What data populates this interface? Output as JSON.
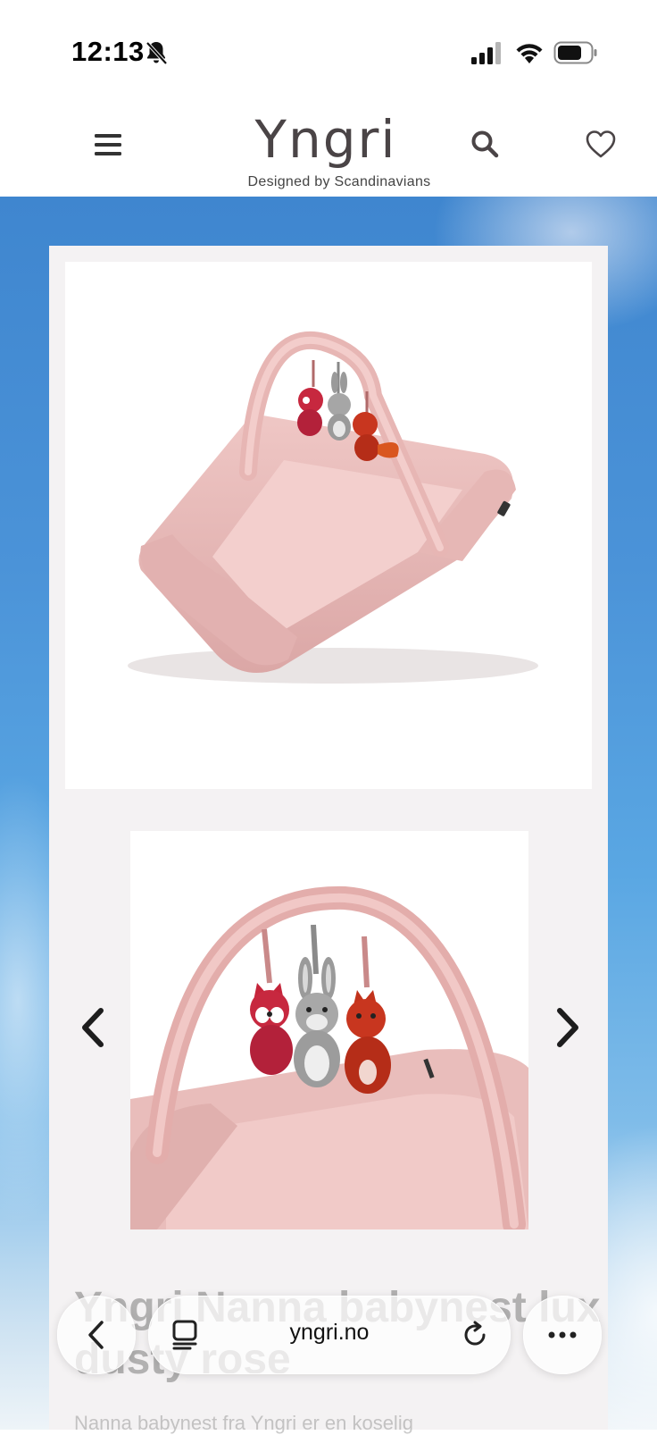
{
  "status_bar": {
    "time": "12:13",
    "icons": [
      "bell-slash-icon",
      "cellular-signal-icon",
      "wifi-icon",
      "battery-icon"
    ]
  },
  "header": {
    "logo_text": "Yngri",
    "tagline": "Designed by Scandinavians",
    "icons": [
      "hamburger-menu-icon",
      "search-icon",
      "heart-icon"
    ]
  },
  "product": {
    "title": "Yngri Nanna babynest lux dusty rose",
    "description": "Nanna babynest fra Yngri er en koselig"
  },
  "gallery": {
    "main_image": "pink babynest with play arch and three plush animals",
    "thumbnail_image": "close-up of play arch with fox, rabbit and squirrel toys"
  },
  "browser_bar": {
    "url": "yngri.no"
  },
  "colors": {
    "card_background": "#f4f2f3",
    "nest_pink": "#e8b8b8",
    "logo_color": "#4a4446"
  }
}
